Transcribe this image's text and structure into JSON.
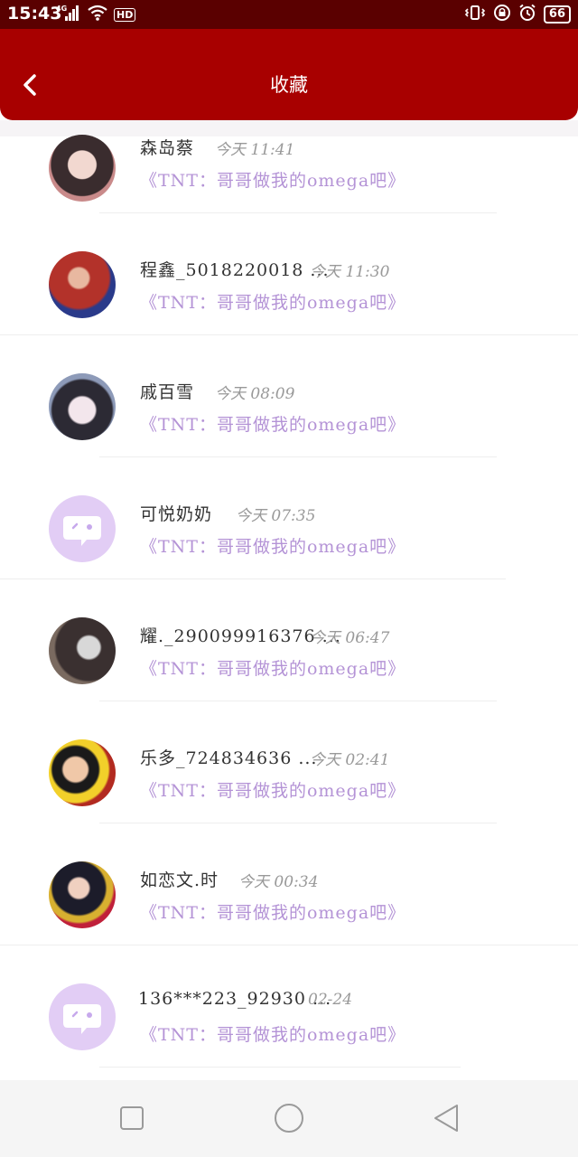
{
  "status_bar": {
    "time": "15:43",
    "network": "4G",
    "hd": "HD",
    "battery": "66",
    "icons": [
      "signal-icon",
      "wifi-icon",
      "vibrate-icon",
      "lock-rotation-icon",
      "alarm-icon",
      "battery-icon"
    ]
  },
  "header": {
    "title": "收藏",
    "back_icon": "chevron-left-icon",
    "background": "#a80000"
  },
  "items": [
    {
      "name": "森岛蔡",
      "time": "今天 11:41",
      "subtitle": "《TNT：哥哥做我的omega吧》",
      "avatar": "photo"
    },
    {
      "name": "程鑫_5018220018 ...",
      "time": "今天 11:30",
      "subtitle": "《TNT：哥哥做我的omega吧》",
      "avatar": "photo"
    },
    {
      "name": "戚百雪",
      "time": "今天 08:09",
      "subtitle": "《TNT：哥哥做我的omega吧》",
      "avatar": "photo"
    },
    {
      "name": "可悦奶奶",
      "time": "今天 07:35",
      "subtitle": "《TNT：哥哥做我的omega吧》",
      "avatar": "default-chat-icon"
    },
    {
      "name": "耀._290099916376 ...",
      "time": "今天 06:47",
      "subtitle": "《TNT：哥哥做我的omega吧》",
      "avatar": "photo"
    },
    {
      "name": "乐多_724834636 ...",
      "time": "今天 02:41",
      "subtitle": "《TNT：哥哥做我的omega吧》",
      "avatar": "photo"
    },
    {
      "name": "如恋文.时",
      "time": "今天 00:34",
      "subtitle": "《TNT：哥哥做我的omega吧》",
      "avatar": "photo"
    },
    {
      "name": "136***223_92930 ...",
      "time": "02-24",
      "subtitle": "《TNT：哥哥做我的omega吧》",
      "avatar": "default-chat-icon"
    }
  ],
  "colors": {
    "status_bar": "#5a0000",
    "subtitle": "#b493d6",
    "default_avatar_bg": "#e2cdf5"
  },
  "nav_bar": {
    "buttons": [
      "recent-apps-icon",
      "home-icon",
      "back-triangle-icon"
    ]
  }
}
